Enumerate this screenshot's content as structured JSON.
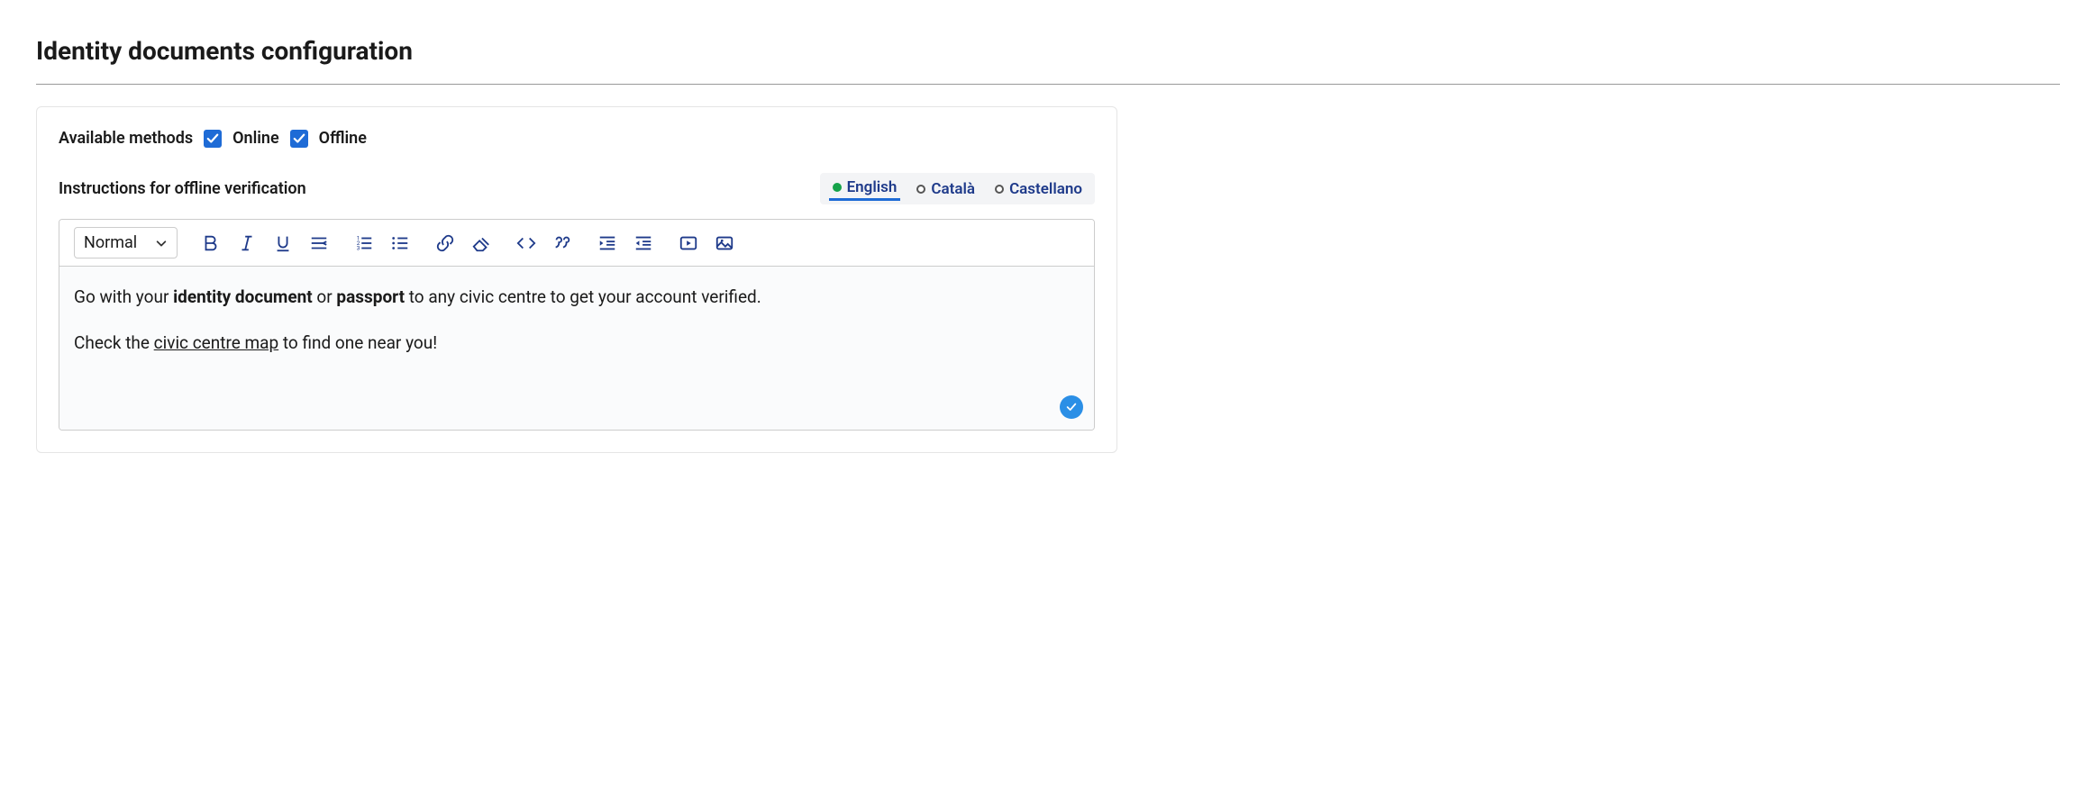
{
  "page": {
    "title": "Identity documents configuration"
  },
  "methods": {
    "label": "Available methods",
    "online": {
      "label": "Online",
      "checked": true
    },
    "offline": {
      "label": "Offline",
      "checked": true
    }
  },
  "instructions": {
    "label": "Instructions for offline verification"
  },
  "languages": {
    "tabs": [
      {
        "label": "English",
        "active": true,
        "filled": true
      },
      {
        "label": "Català",
        "active": false,
        "filled": false
      },
      {
        "label": "Castellano",
        "active": false,
        "filled": false
      }
    ]
  },
  "toolbar": {
    "format_select": "Normal"
  },
  "editor": {
    "p1_part1": "Go with your ",
    "p1_bold1": "identity document",
    "p1_part2": " or ",
    "p1_bold2": "passport",
    "p1_part3": " to any civic centre to get your account verified.",
    "p2_part1": "Check the ",
    "p2_link": "civic centre map",
    "p2_part2": " to find one near you!"
  }
}
